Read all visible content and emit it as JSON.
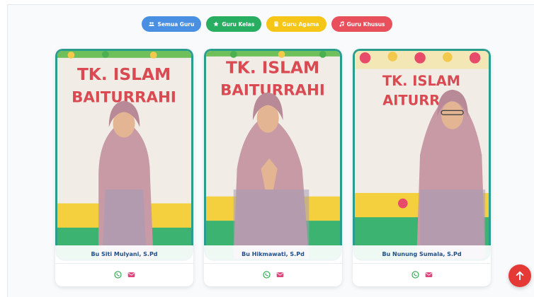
{
  "filters": [
    {
      "label": "Semua Guru",
      "icon": "users-icon",
      "color": "#4a90e2"
    },
    {
      "label": "Guru Kelas",
      "icon": "star-icon",
      "color": "#27ae60"
    },
    {
      "label": "Guru Agama",
      "icon": "book-icon",
      "color": "#f5c518"
    },
    {
      "label": "Guru Khusus",
      "icon": "music-icon",
      "color": "#e8505b"
    }
  ],
  "teachers": [
    {
      "name": "Bu Siti Mulyani, S.Pd",
      "banner_line1": "TK. ISLAM",
      "banner_line2": "BAITURRAHI"
    },
    {
      "name": "Bu Hikmawati, S.Pd",
      "banner_line1": "TK. ISLAM",
      "banner_line2": "BAITURRAHI"
    },
    {
      "name": "Bu Nunung Sumala, S.Pd",
      "banner_line1": "TK. ISLAM",
      "banner_line2": "AITURRA"
    }
  ],
  "colors": {
    "card_border": "#2a9d8f",
    "whatsapp": "#25a244",
    "email": "#e0457b",
    "back_to_top": "#e53935"
  }
}
